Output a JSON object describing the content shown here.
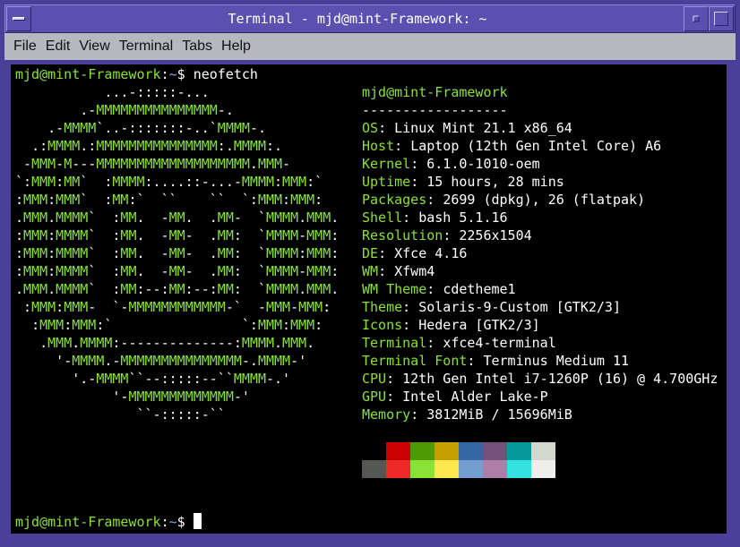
{
  "window": {
    "title": "Terminal - mjd@mint-Framework: ~",
    "colors": {
      "frame": "#4b3f9a",
      "titlebar": "#5b4fb0",
      "menubar": "#b6b8bf",
      "terminal_bg": "#000000",
      "prompt_green": "#8ae234",
      "prompt_path_blue": "#7fa4d8"
    }
  },
  "menu": [
    "File",
    "Edit",
    "View",
    "Terminal",
    "Tabs",
    "Help"
  ],
  "prompt": {
    "user_host": "mjd@mint-Framework",
    "sep": ":",
    "path": "~",
    "symbol": "$ ",
    "command": "neofetch"
  },
  "ascii_logo": [
    "           ...-:::::-...",
    "        .-MMMMMMMMMMMMMMM-.",
    "    .-MMMM`..-:::::::-..`MMMM-.",
    "  .:MMMM.:MMMMMMMMMMMMMMM:.MMMM:.",
    " -MMM-M---MMMMMMMMMMMMMMMMMMM.MMM-",
    "`:MMM:MM`  :MMMM:....::-...-MMMM:MMM:`",
    ":MMM:MMM`  :MM:`  ``    ``  `:MMM:MMM:",
    ".MMM.MMMM`  :MM.  -MM.  .MM-  `MMMM.MMM.",
    ":MMM:MMMM`  :MM.  -MM-  .MM:  `MMMM-MMM:",
    ":MMM:MMMM`  :MM.  -MM-  .MM:  `MMMM:MMM:",
    ":MMM:MMMM`  :MM.  -MM-  .MM:  `MMMM-MMM:",
    ".MMM.MMMM`  :MM:--:MM:--:MM:  `MMMM.MMM.",
    " :MMM:MMM-  `-MMMMMMMMMMMM-`  -MMM-MMM:",
    "  :MMM:MMM:`                `:MMM:MMM:",
    "   .MMM.MMMM:--------------:MMMM.MMM.",
    "     '-MMMM.-MMMMMMMMMMMMMMM-.MMMM-'",
    "       '.-MMMM``--:::::--``MMMM-.'",
    "            '-MMMMMMMMMMMMM-'",
    "               ``-:::::-``"
  ],
  "info": {
    "header": "mjd@mint-Framework",
    "divider": "------------------",
    "fields": [
      {
        "key": "OS",
        "value": "Linux Mint 21.1 x86_64"
      },
      {
        "key": "Host",
        "value": "Laptop (12th Gen Intel Core) A6"
      },
      {
        "key": "Kernel",
        "value": "6.1.0-1010-oem"
      },
      {
        "key": "Uptime",
        "value": "15 hours, 28 mins"
      },
      {
        "key": "Packages",
        "value": "2699 (dpkg), 26 (flatpak)"
      },
      {
        "key": "Shell",
        "value": "bash 5.1.16"
      },
      {
        "key": "Resolution",
        "value": "2256x1504"
      },
      {
        "key": "DE",
        "value": "Xfce 4.16"
      },
      {
        "key": "WM",
        "value": "Xfwm4"
      },
      {
        "key": "WM Theme",
        "value": "cdetheme1"
      },
      {
        "key": "Theme",
        "value": "Solaris-9-Custom [GTK2/3]"
      },
      {
        "key": "Icons",
        "value": "Hedera [GTK2/3]"
      },
      {
        "key": "Terminal",
        "value": "xfce4-terminal"
      },
      {
        "key": "Terminal Font",
        "value": "Terminus Medium 11"
      },
      {
        "key": "CPU",
        "value": "12th Gen Intel i7-1260P (16) @ 4.700GHz"
      },
      {
        "key": "GPU",
        "value": "Intel Alder Lake-P"
      },
      {
        "key": "Memory",
        "value": "3812MiB / 15696MiB"
      }
    ],
    "palette_row1": [
      "#000000",
      "#cc0000",
      "#4e9a06",
      "#c4a000",
      "#3465a4",
      "#75507b",
      "#06989a",
      "#d3d7cf"
    ],
    "palette_row2": [
      "#555753",
      "#ef2929",
      "#8ae234",
      "#fce94f",
      "#729fcf",
      "#ad7fa8",
      "#34e2e2",
      "#eeeeec"
    ]
  }
}
